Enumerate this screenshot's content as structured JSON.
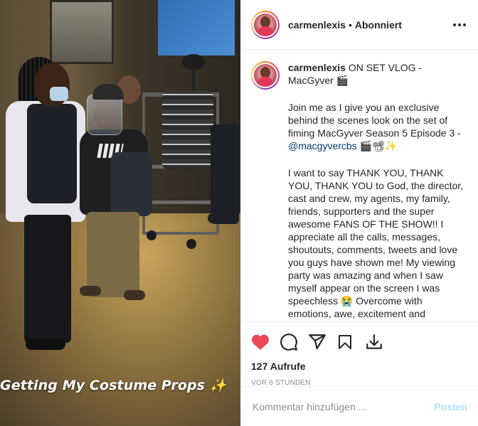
{
  "colors": {
    "like_red": "#ed4956",
    "link_blue": "#00376b",
    "post_button_disabled": "#b2dffc",
    "muted_gray": "#8e8e8e"
  },
  "media": {
    "caption_overlay": "Getting My Costume Props ✨"
  },
  "header": {
    "username": "carmenlexis",
    "separator": "•",
    "follow_status": "Abonniert",
    "more_icon": "more-horizontal-icon"
  },
  "caption": {
    "username": "carmenlexis",
    "title": "ON SET VLOG - MacGyver 🎬",
    "para1_before": "Join me as I give you an exclusive behind the scenes look on the set of fiming MacGyver Season 5 Episode 3 - ",
    "mention": "@macgyvercbs",
    "para1_after": " 🎬📽✨",
    "para2": "I want to say THANK YOU, THANK YOU, THANK YOU to God, the director, cast and crew, my agents, my family, friends, supporters and the super awesome FANS OF THE SHOW!! I appreciate all the calls, messages, shoutouts, comments, tweets and love you guys have shown me! My viewing party was amazing and when I saw myself appear on the screen I was speechless 😭 Overcome with emotions, awe, excitement and"
  },
  "actions": {
    "like_icon": "heart-filled-icon",
    "comment_icon": "comment-bubble-icon",
    "share_icon": "paper-plane-icon",
    "save_icon": "bookmark-icon",
    "download_icon": "download-icon",
    "views": "127 Aufrufe",
    "timestamp": "VOR 6 STUNDEN"
  },
  "comment_form": {
    "placeholder": "Kommentar hinzufügen ...",
    "post_label": "Posten"
  }
}
